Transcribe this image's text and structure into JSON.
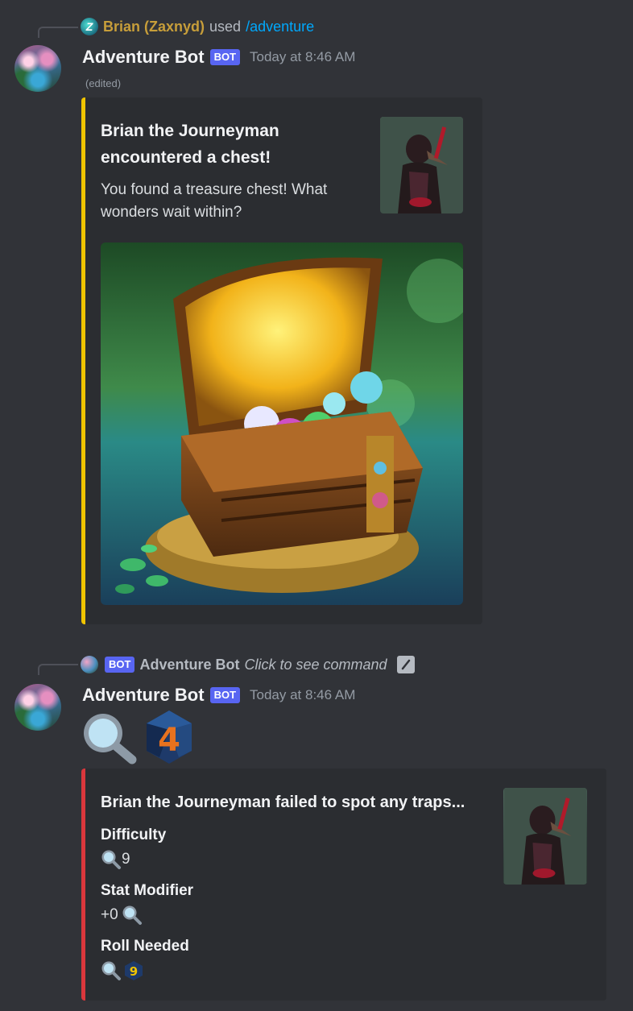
{
  "messages": [
    {
      "reference": {
        "username": "Brian (Zaxnyd)",
        "used_text": "used",
        "command": "/adventure"
      },
      "author": "Adventure Bot",
      "bot_tag": "BOT",
      "timestamp": "Today at 8:46 AM",
      "edited": "(edited)",
      "embed": {
        "accent_color": "#f0c400",
        "title_line1": "Brian the Journeyman",
        "title_line2": "encountered a chest!",
        "description_line1": "You found a treasure chest! What",
        "description_line2": "wonders wait within?",
        "thumbnail": "plague-doctor-adventurer-image",
        "image": "treasure-chest-image"
      }
    },
    {
      "reference": {
        "bot_tag": "BOT",
        "botname": "Adventure Bot",
        "click_text": "Click to see command",
        "icon": "slash-command-icon"
      },
      "author": "Adventure Bot",
      "bot_tag": "BOT",
      "timestamp": "Today at 8:46 AM",
      "content_emojis": [
        "magnifying-glass-icon",
        "d20-dice-icon"
      ],
      "dice_value": "4",
      "embed": {
        "accent_color": "#da373c",
        "title": "Brian the Journeyman failed to spot any traps...",
        "thumbnail": "plague-doctor-adventurer-image",
        "fields": [
          {
            "name": "Difficulty",
            "value": "9",
            "emoji": "magnifying-glass-icon"
          },
          {
            "name": "Stat Modifier",
            "value": "+0",
            "emoji": "magnifying-glass-icon"
          },
          {
            "name": "Roll Needed",
            "value": "9",
            "emoji": "magnifying-glass-icon"
          }
        ]
      }
    }
  ],
  "colors": {
    "background": "#313338",
    "embed_background": "#2b2d31",
    "bot_tag": "#5865f2",
    "username_reply": "#c79e3a",
    "command_link": "#00a8fc"
  }
}
